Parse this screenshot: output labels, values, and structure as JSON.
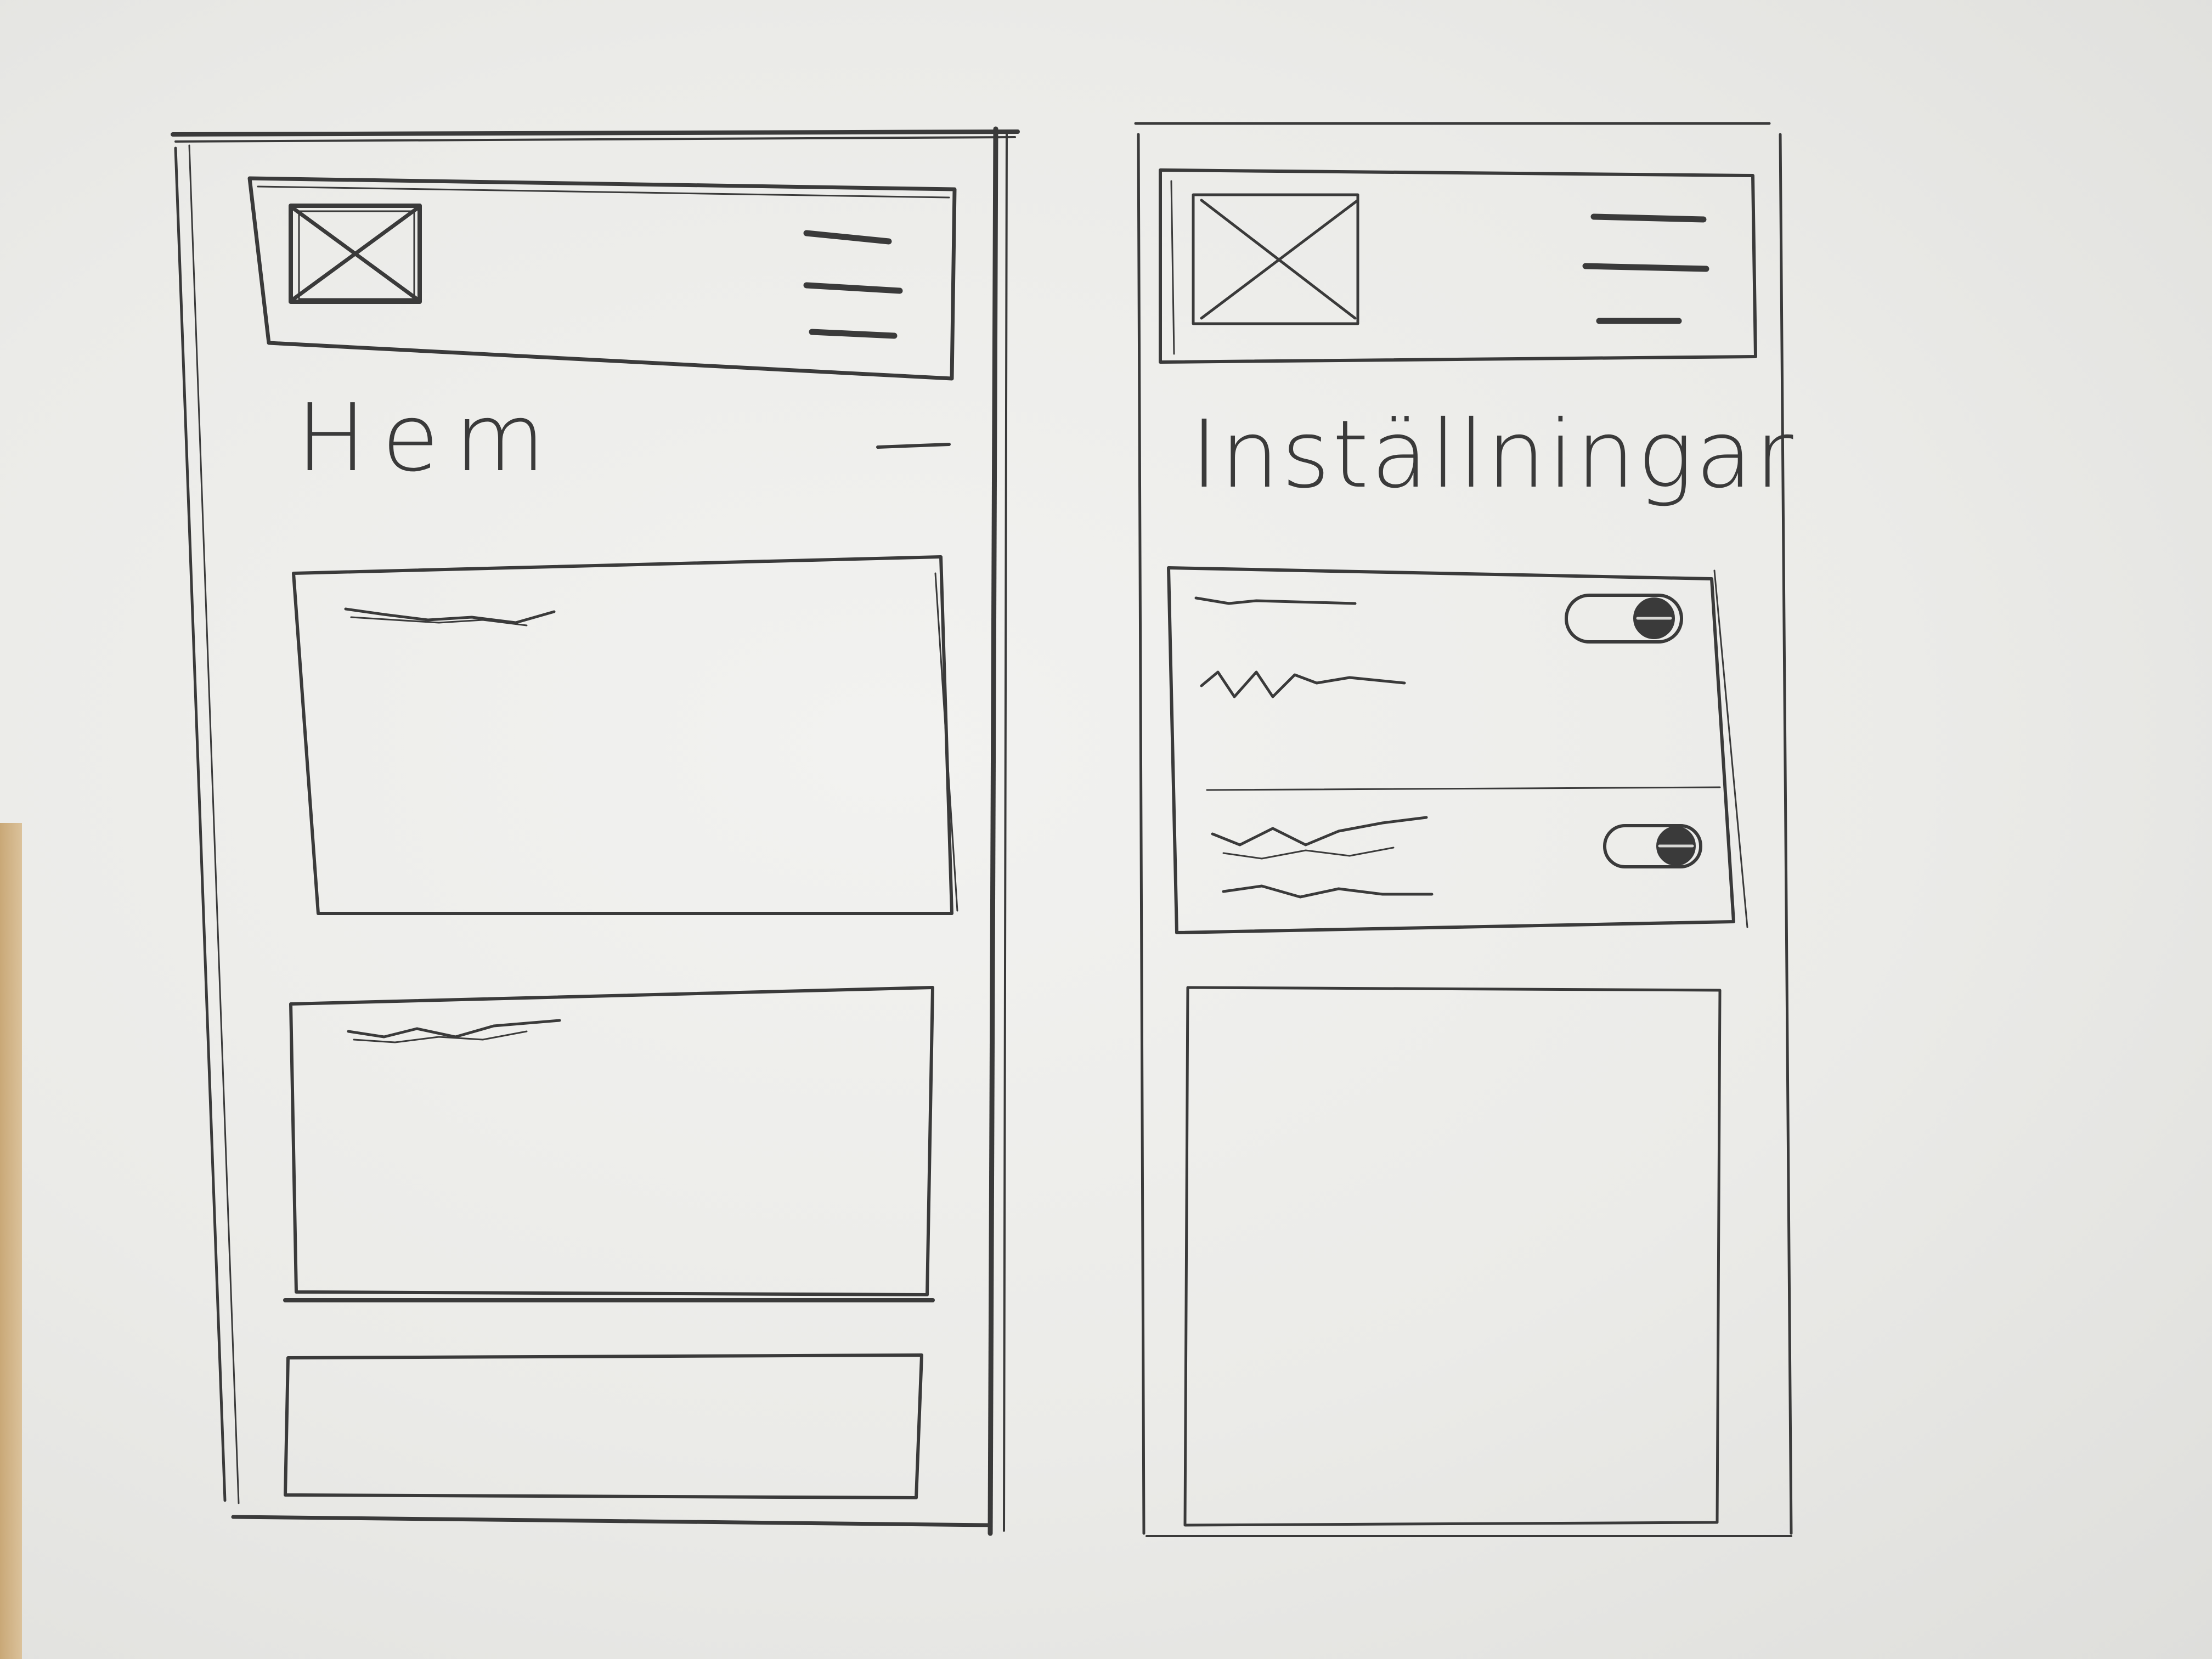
{
  "screens": {
    "home": {
      "title": "Hem",
      "header": {
        "logo_icon": "image-placeholder-icon",
        "menu_icon": "hamburger-menu-icon"
      },
      "cards": [
        {
          "heading_icon": "squiggle-text-placeholder"
        },
        {
          "heading_icon": "squiggle-text-placeholder"
        },
        {}
      ],
      "collapse_icon": "minus-icon"
    },
    "settings": {
      "title": "Inställningar",
      "header": {
        "logo_icon": "image-placeholder-icon",
        "menu_icon": "hamburger-menu-icon"
      },
      "settings_group": {
        "rows": [
          {
            "toggle_state": "on",
            "label_icon": "squiggle-text-placeholder"
          },
          {
            "toggle_state": "on",
            "label_icon": "squiggle-text-placeholder"
          }
        ]
      }
    }
  },
  "colors": {
    "pencil": "#3a3a3a",
    "paper": "#efefec"
  }
}
